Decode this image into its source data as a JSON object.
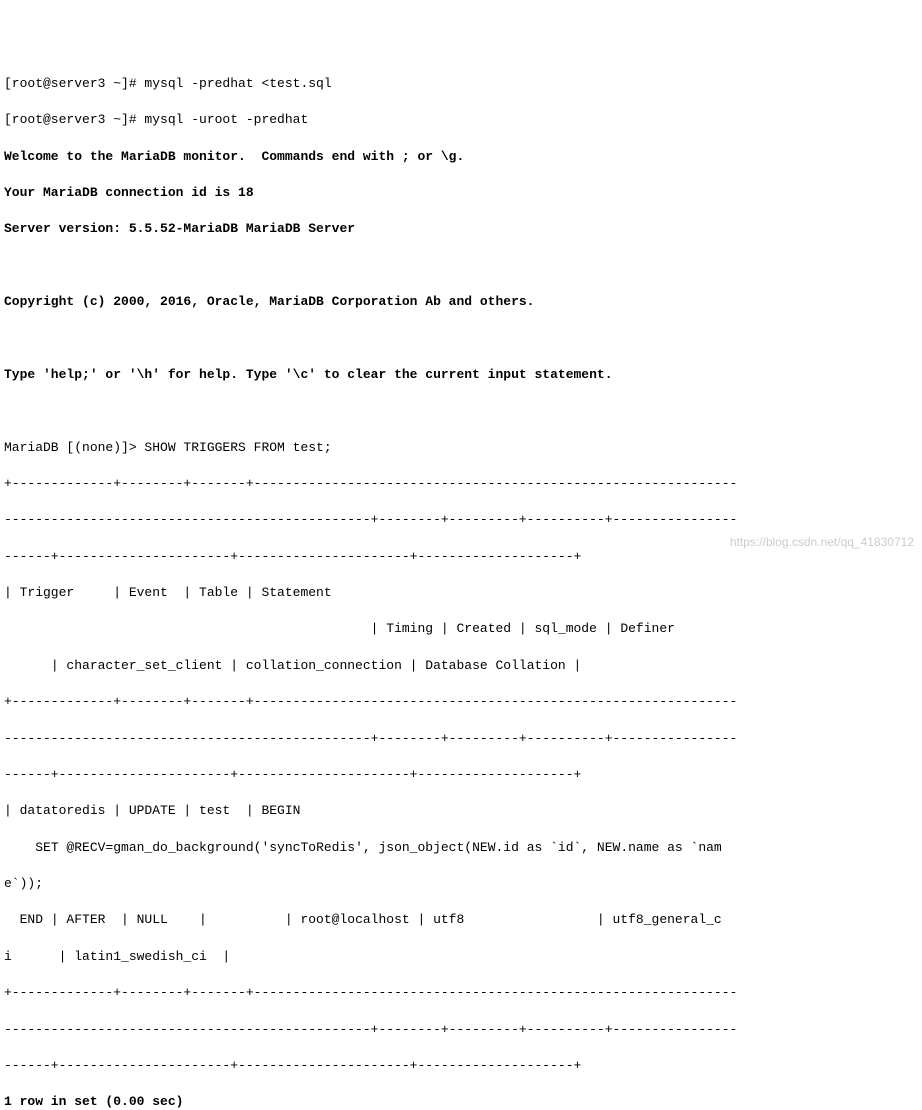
{
  "terminal": {
    "prompt1": "[root@server3 ~]# mysql -predhat <test.sql",
    "prompt2": "[root@server3 ~]# mysql -uroot -predhat",
    "welcome1": "Welcome to the MariaDB monitor.  Commands end with ; or \\g.",
    "welcome2": "Your MariaDB connection id is 18",
    "welcome3": "Server version: 5.5.52-MariaDB MariaDB Server",
    "copyright": "Copyright (c) 2000, 2016, Oracle, MariaDB Corporation Ab and others.",
    "help": "Type 'help;' or '\\h' for help. Type '\\c' to clear the current input statement.",
    "mariadb_prompt": "MariaDB [(none)]> SHOW TRIGGERS FROM test;",
    "sep1": "+-------------+--------+-------+--------------------------------------------------------------",
    "sep2": "-----------------------------------------------+--------+---------+----------+----------------",
    "sep3": "------+----------------------+----------------------+--------------------+",
    "header1": "| Trigger     | Event  | Table | Statement                                                    ",
    "header2": "                                               | Timing | Created | sql_mode | Definer        ",
    "header3": "      | character_set_client | collation_connection | Database Collation |",
    "row1": "| datatoredis | UPDATE | test  | BEGIN",
    "row2": "    SET @RECV=gman_do_background('syncToRedis', json_object(NEW.id as `id`, NEW.name as `nam",
    "row3": "e`));",
    "row4": "  END | AFTER  | NULL    |          | root@localhost | utf8                 | utf8_general_c",
    "row5": "i      | latin1_swedish_ci  |",
    "footer": "1 row in set (0.00 sec)"
  },
  "watermark": "https://blog.csdn.net/qq_41830712"
}
